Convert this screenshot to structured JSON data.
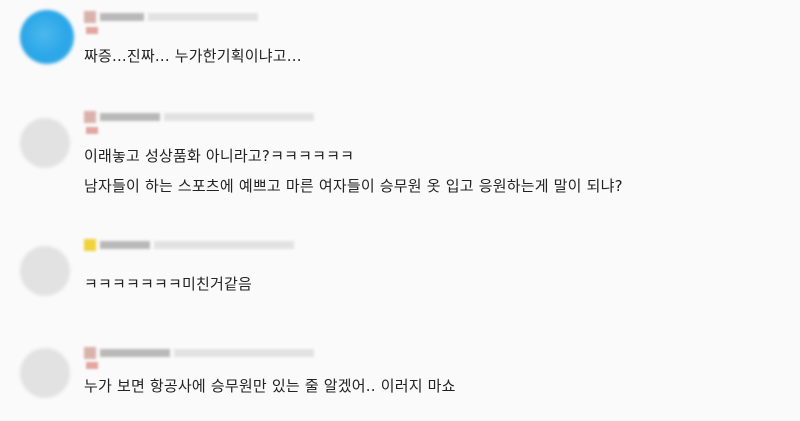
{
  "comments": [
    {
      "author": "",
      "lines": [
        "짜증...진짜... 누가한기획이냐고..."
      ]
    },
    {
      "author": "",
      "lines": [
        "이래놓고 성상품화 아니라고?ㅋㅋㅋㅋㅋㅋ",
        "남자들이 하는 스포츠에 예쁘고 마른 여자들이 승무원 옷 입고 응원하는게 말이 되냐?"
      ]
    },
    {
      "author": "",
      "lines": [
        "ㅋㅋㅋㅋㅋㅋㅋ미친거같음"
      ]
    },
    {
      "author": "",
      "lines": [
        "누가 보면 항공사에 승무원만 있는 줄 알겠어.. 이러지 마쇼"
      ]
    }
  ],
  "colors": {
    "background": "#fafafa",
    "text": "#222222",
    "avatar_primary": "#2aa6e8",
    "avatar_default": "#e2e2e2",
    "badge_yellow": "#f0d23a"
  }
}
